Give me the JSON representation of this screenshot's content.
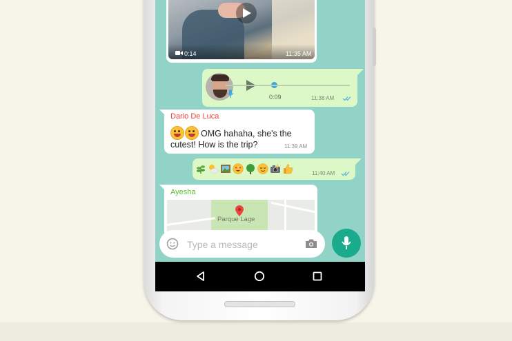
{
  "chat": {
    "video_message": {
      "duration": "0:14",
      "time": "11:35 AM"
    },
    "voice_message": {
      "duration": "0:09",
      "time": "11:38 AM"
    },
    "text_message": {
      "sender": "Dario De Luca",
      "line1": "OMG hahaha, she's the",
      "line2": "cutest! How is the trip?",
      "time": "11:39 AM"
    },
    "emoji_message": {
      "emojis": [
        "herb",
        "sun-behind-cloud",
        "framed-picture",
        "heart-eyes",
        "deciduous-tree",
        "relieved-face",
        "camera-flash",
        "thumbs-up"
      ],
      "time": "11:40 AM"
    },
    "location_message": {
      "sender": "Ayesha",
      "place": "Parque Lage"
    }
  },
  "composer": {
    "placeholder": "Type a message"
  },
  "colors": {
    "chat_background": "#92d3c8",
    "outgoing_bubble": "#dcf8c6",
    "incoming_bubble": "#ffffff",
    "accent": "#1aaa8c",
    "sender_red": "#e8453c",
    "sender_green": "#5cbf3a",
    "read_ticks": "#4fb3e8"
  },
  "icons": [
    "play-icon",
    "video-camera-icon",
    "mic-icon",
    "double-check-icon",
    "location-pin-icon",
    "smiley-icon",
    "camera-icon",
    "back-icon",
    "home-icon",
    "recents-icon"
  ]
}
